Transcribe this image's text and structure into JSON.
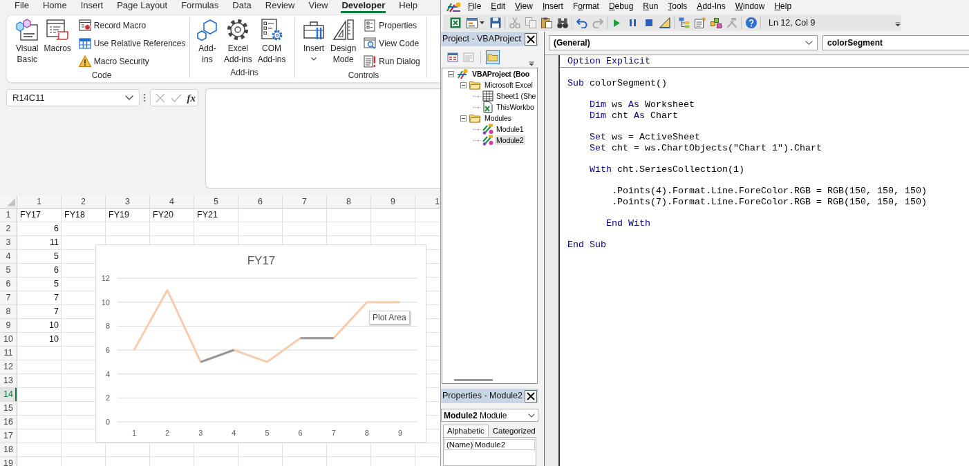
{
  "excel": {
    "ribbon_tabs": [
      {
        "label": "File",
        "selected": false
      },
      {
        "label": "Home",
        "selected": false
      },
      {
        "label": "Insert",
        "selected": false
      },
      {
        "label": "Page Layout",
        "selected": false
      },
      {
        "label": "Formulas",
        "selected": false
      },
      {
        "label": "Data",
        "selected": false
      },
      {
        "label": "Review",
        "selected": false
      },
      {
        "label": "View",
        "selected": false
      },
      {
        "label": "Developer",
        "selected": true
      },
      {
        "label": "Help",
        "selected": false
      }
    ],
    "ribbon_groups": [
      {
        "label": "Code",
        "buttons": [
          {
            "kind": "large",
            "lines": [
              "Visual",
              "Basic"
            ],
            "dropdown": false
          },
          {
            "kind": "large",
            "lines": [
              "Macros"
            ],
            "dropdown": false
          },
          {
            "kind": "small",
            "lines": [
              "Record Macro"
            ],
            "dropdown": false
          },
          {
            "kind": "small",
            "lines": [
              "Use Relative References"
            ],
            "dropdown": false
          },
          {
            "kind": "small",
            "lines": [
              "Macro Security"
            ],
            "dropdown": false
          }
        ]
      },
      {
        "label": "Add-ins",
        "buttons": [
          {
            "kind": "large",
            "lines": [
              "Add-",
              "ins"
            ],
            "dropdown": false
          },
          {
            "kind": "large",
            "lines": [
              "Excel",
              "Add-ins"
            ],
            "dropdown": false
          },
          {
            "kind": "large",
            "lines": [
              "COM",
              "Add-ins"
            ],
            "dropdown": false
          }
        ]
      },
      {
        "label": "Controls",
        "buttons": [
          {
            "kind": "large",
            "lines": [
              "Insert"
            ],
            "dropdown": true
          },
          {
            "kind": "large",
            "lines": [
              "Design",
              "Mode"
            ],
            "dropdown": false
          },
          {
            "kind": "small",
            "lines": [
              "Properties"
            ],
            "dropdown": false
          },
          {
            "kind": "small",
            "lines": [
              "View Code"
            ],
            "dropdown": false
          },
          {
            "kind": "small",
            "lines": [
              "Run Dialog"
            ],
            "dropdown": false
          }
        ]
      }
    ],
    "name_box": {
      "value": "R14C11"
    },
    "formula_bar": {
      "buttons": [
        {
          "disabled": true
        },
        {
          "disabled": true
        }
      ],
      "function_label": "fx"
    },
    "sheet": {
      "columns": [
        "1",
        "2",
        "3",
        "4",
        "5",
        "6",
        "7",
        "8",
        "9",
        "1"
      ],
      "rows": [
        {
          "header": "1",
          "selected": false,
          "cells": [
            {
              "kind": "text",
              "text": "FY17"
            },
            {
              "kind": "text",
              "text": "FY18"
            },
            {
              "kind": "text",
              "text": "FY19"
            },
            {
              "kind": "text",
              "text": "FY20"
            },
            {
              "kind": "text",
              "text": "FY21"
            }
          ]
        },
        {
          "header": "2",
          "selected": false,
          "cells": [
            {
              "kind": "number",
              "text": "6"
            }
          ]
        },
        {
          "header": "3",
          "selected": false,
          "cells": [
            {
              "kind": "number",
              "text": "11"
            }
          ]
        },
        {
          "header": "4",
          "selected": false,
          "cells": [
            {
              "kind": "number",
              "text": "5"
            }
          ]
        },
        {
          "header": "5",
          "selected": false,
          "cells": [
            {
              "kind": "number",
              "text": "6"
            }
          ]
        },
        {
          "header": "6",
          "selected": false,
          "cells": [
            {
              "kind": "number",
              "text": "5"
            }
          ]
        },
        {
          "header": "7",
          "selected": false,
          "cells": [
            {
              "kind": "number",
              "text": "7"
            }
          ]
        },
        {
          "header": "8",
          "selected": false,
          "cells": [
            {
              "kind": "number",
              "text": "7"
            }
          ]
        },
        {
          "header": "9",
          "selected": false,
          "cells": [
            {
              "kind": "number",
              "text": "10"
            }
          ]
        },
        {
          "header": "10",
          "selected": false,
          "cells": [
            {
              "kind": "number",
              "text": "10"
            }
          ]
        },
        {
          "header": "11",
          "selected": false
        },
        {
          "header": "12",
          "selected": false
        },
        {
          "header": "13",
          "selected": false
        },
        {
          "header": "14",
          "selected": true
        },
        {
          "header": "15",
          "selected": false
        },
        {
          "header": "16",
          "selected": false
        },
        {
          "header": "17",
          "selected": false
        },
        {
          "header": "18",
          "selected": false
        },
        {
          "header": "19",
          "selected": false
        }
      ]
    },
    "chart": {
      "chart_data": {
        "type": "line",
        "title": "FY17",
        "categories": [
          "1",
          "2",
          "3",
          "4",
          "5",
          "6",
          "7",
          "8",
          "9"
        ],
        "series": [
          {
            "color": "#f8cbad",
            "values": [
              6,
              11,
              5,
              6,
              5,
              7,
              7,
              10,
              10
            ]
          },
          {
            "color": "#969696",
            "values": [
              null,
              null,
              5,
              6,
              null,
              7,
              7,
              null,
              null
            ]
          }
        ],
        "ylim": [
          0,
          12
        ],
        "yticks": [
          0,
          2,
          4,
          6,
          8,
          10,
          12
        ],
        "grid": true
      },
      "tooltip": "Plot Area"
    }
  },
  "vbe": {
    "menu": [
      {
        "key": "F",
        "after": "ile"
      },
      {
        "key": "E",
        "after": "dit"
      },
      {
        "key": "V",
        "after": "iew"
      },
      {
        "key": "I",
        "after": "nsert"
      },
      {
        "before": "F",
        "key": "o",
        "after": "rmat"
      },
      {
        "key": "D",
        "after": "ebug"
      },
      {
        "key": "R",
        "after": "un"
      },
      {
        "key": "T",
        "after": "ools"
      },
      {
        "key": "A",
        "after": "dd-Ins"
      },
      {
        "key": "W",
        "after": "indow"
      },
      {
        "key": "H",
        "after": "elp"
      }
    ],
    "toolbar": {
      "groups": [
        [
          {
            "disabled": false,
            "dropdown": false
          },
          {
            "disabled": false,
            "dropdown": true
          },
          {
            "disabled": false,
            "dropdown": false
          }
        ],
        [
          {
            "disabled": true,
            "dropdown": false
          },
          {
            "disabled": true,
            "dropdown": false
          },
          {
            "disabled": false,
            "dropdown": false
          },
          {
            "disabled": false,
            "dropdown": false
          }
        ],
        [
          {
            "disabled": false,
            "dropdown": false
          },
          {
            "disabled": true,
            "dropdown": false
          }
        ],
        [
          {
            "disabled": false,
            "dropdown": false
          },
          {
            "disabled": false,
            "dropdown": false
          },
          {
            "disabled": false,
            "dropdown": false
          },
          {
            "disabled": false,
            "dropdown": false
          }
        ],
        [
          {
            "disabled": false,
            "dropdown": false
          },
          {
            "disabled": false,
            "dropdown": false
          },
          {
            "disabled": false,
            "dropdown": false
          },
          {
            "disabled": true,
            "dropdown": false
          }
        ],
        [
          {
            "disabled": false,
            "dropdown": false
          }
        ]
      ],
      "position": "Ln 12, Col 9"
    },
    "project": {
      "title": "Project - VBAProject",
      "toolbar": [
        {
          "selected": false,
          "disabled": false
        },
        {
          "selected": false,
          "disabled": true
        },
        {
          "selected": true,
          "disabled": false
        }
      ],
      "tree": [
        {
          "kind": "project",
          "label": "VBAProject (Boo",
          "expanded": true,
          "selected": false,
          "children": [
            {
              "kind": "folder",
              "label": "Microsoft Excel",
              "expanded": true,
              "selected": false,
              "children": [
                {
                  "kind": "sheet",
                  "label": "Sheet1 (She",
                  "selected": false
                },
                {
                  "kind": "workbook",
                  "label": "ThisWorkbo",
                  "selected": false
                }
              ]
            },
            {
              "kind": "folder",
              "label": "Modules",
              "expanded": true,
              "selected": false,
              "children": [
                {
                  "kind": "module",
                  "label": "Module1",
                  "selected": false
                },
                {
                  "kind": "module",
                  "label": "Module2",
                  "selected": true
                }
              ]
            }
          ]
        }
      ]
    },
    "properties": {
      "title": "Properties - Module2",
      "object": {
        "name": "Module2",
        "type": "Module"
      },
      "tabs": [
        {
          "label": "Alphabetic",
          "selected": true
        },
        {
          "label": "Categorized",
          "selected": false
        }
      ],
      "rows": [
        {
          "name": "(Name)",
          "value": "Module2"
        }
      ]
    },
    "code": {
      "object": "(General)",
      "procedure": "colorSegment",
      "sections": [
        {
          "blocks": [
            [
              {
                "tokens": [
                  {
                    "kind": "keyword",
                    "text": "Option Explicit"
                  }
                ]
              }
            ]
          ]
        },
        {
          "blocks": [
            [
              {
                "tokens": [
                  {
                    "kind": "keyword",
                    "text": "Sub"
                  },
                  {
                    "kind": "plain",
                    "text": " colorSegment()"
                  }
                ]
              }
            ],
            [
              {
                "tokens": [
                  {
                    "kind": "keyword",
                    "text": "    Dim"
                  },
                  {
                    "kind": "plain",
                    "text": " ws "
                  },
                  {
                    "kind": "keyword",
                    "text": "As"
                  },
                  {
                    "kind": "plain",
                    "text": " Worksheet"
                  }
                ]
              },
              {
                "tokens": [
                  {
                    "kind": "keyword",
                    "text": "    Dim"
                  },
                  {
                    "kind": "plain",
                    "text": " cht "
                  },
                  {
                    "kind": "keyword",
                    "text": "As"
                  },
                  {
                    "kind": "plain",
                    "text": " Chart"
                  }
                ]
              }
            ],
            [
              {
                "tokens": [
                  {
                    "kind": "keyword",
                    "text": "    Set"
                  },
                  {
                    "kind": "plain",
                    "text": " ws = ActiveSheet"
                  }
                ]
              },
              {
                "tokens": [
                  {
                    "kind": "keyword",
                    "text": "    Set"
                  },
                  {
                    "kind": "plain",
                    "text": " cht = ws.ChartObjects(\"Chart 1\").Chart"
                  }
                ]
              }
            ],
            [
              {
                "tokens": [
                  {
                    "kind": "keyword",
                    "text": "    With"
                  },
                  {
                    "kind": "plain",
                    "text": " cht.SeriesCollection(1)"
                  }
                ]
              }
            ],
            [
              {
                "tokens": [
                  {
                    "kind": "plain",
                    "text": "        .Points(4).Format.Line.ForeColor.RGB = RGB(150, 150, 150)"
                  }
                ]
              },
              {
                "tokens": [
                  {
                    "kind": "plain",
                    "text": "        .Points(7).Format.Line.ForeColor.RGB = RGB(150, 150, 150)"
                  }
                ]
              }
            ],
            [
              {
                "tokens": [
                  {
                    "kind": "keyword",
                    "text": "       End With"
                  }
                ]
              }
            ],
            [
              {
                "tokens": [
                  {
                    "kind": "keyword",
                    "text": "End Sub"
                  }
                ]
              }
            ]
          ]
        }
      ]
    }
  }
}
